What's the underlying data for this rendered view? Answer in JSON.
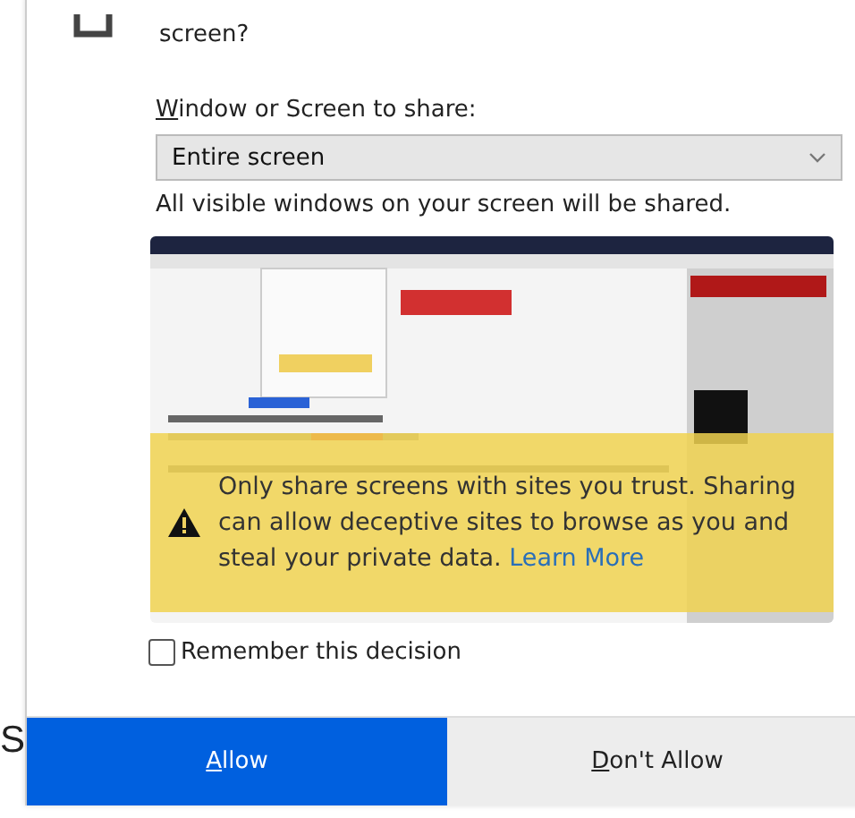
{
  "background_text": [
    "S"
  ],
  "dialog": {
    "question": "screen?",
    "select_label": {
      "accesskey": "W",
      "rest": "indow or Screen to share:"
    },
    "select": {
      "value": "Entire screen"
    },
    "info": "All visible windows on your screen will be shared.",
    "preview": {
      "kind": "picture",
      "warning": "Only share screens with sites you trust. Sharing can allow deceptive sites to browse as you and steal your private data.",
      "link": "Learn More"
    },
    "remember": {
      "label": "Remember this decision",
      "checked": false
    },
    "buttons": [
      {
        "accesskey": "A",
        "rest": "llow",
        "primary": true
      },
      {
        "accesskey": "D",
        "rest": "on't Allow",
        "primary": false
      }
    ]
  }
}
